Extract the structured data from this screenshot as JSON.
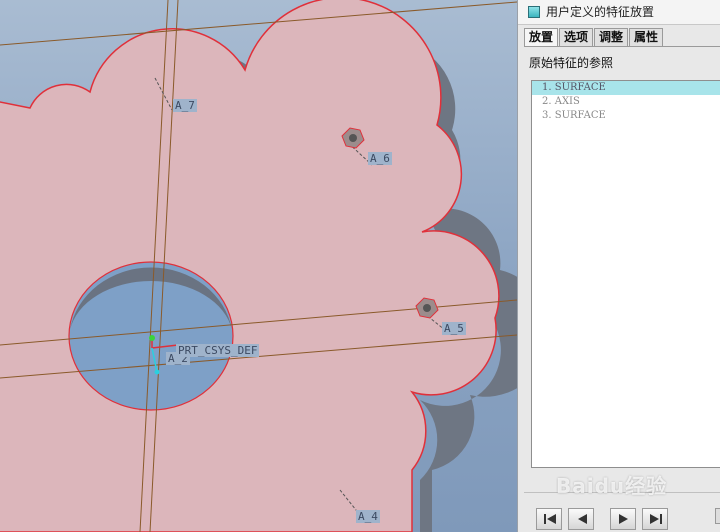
{
  "viewport": {
    "axis_labels": {
      "a7": "A_7",
      "a6": "A_6",
      "a5": "A_5",
      "a4": "A_4",
      "a2": "A_2",
      "csys": "PRT_CSYS_DEF"
    },
    "colors": {
      "part_face": "#dcb6bb",
      "part_edge": "#e0303a",
      "part_side": "#6f7784",
      "datum_line": "#8a5a2a",
      "background": "#8fa9c6"
    }
  },
  "panel": {
    "title": "用户定义的特征放置",
    "title_icon": "feature-icon",
    "tabs": [
      "放置",
      "选项",
      "调整",
      "属性"
    ],
    "active_tab": "放置",
    "ref_heading": "原始特征的参照",
    "references": [
      {
        "label": "1.  SURFACE"
      },
      {
        "label": "2.  AXIS"
      },
      {
        "label": "3.  SURFACE"
      }
    ],
    "selected_reference": 0,
    "nav_buttons": [
      "first-icon",
      "previous-icon",
      "next-icon",
      "last-icon"
    ],
    "watermark": "Baidu经验"
  }
}
